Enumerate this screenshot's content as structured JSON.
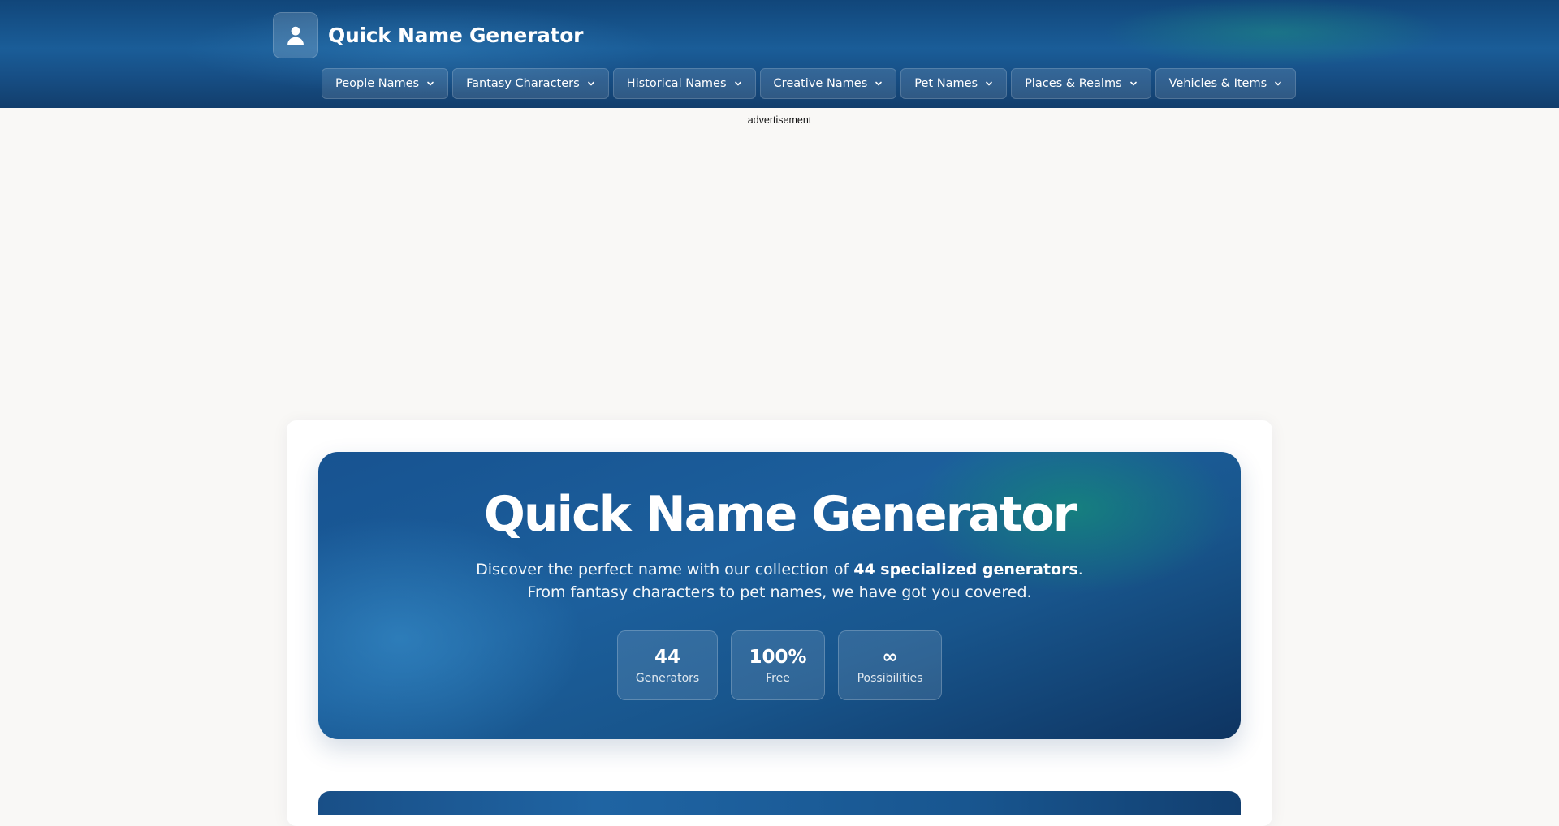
{
  "header": {
    "brand_title": "Quick Name Generator",
    "logo_icon": "user-icon",
    "nav": [
      {
        "label": "People Names"
      },
      {
        "label": "Fantasy Characters"
      },
      {
        "label": "Historical Names"
      },
      {
        "label": "Creative Names"
      },
      {
        "label": "Pet Names"
      },
      {
        "label": "Places & Realms"
      },
      {
        "label": "Vehicles & Items"
      }
    ]
  },
  "ad": {
    "label": "advertisement"
  },
  "hero": {
    "title": "Quick Name Generator",
    "sub_line1_pre": "Discover the perfect name with our collection of ",
    "sub_line1_bold": "44 specialized generators",
    "sub_line1_post": ".",
    "sub_line2": "From fantasy characters to pet names, we have got you covered.",
    "stats": [
      {
        "value": "44",
        "label": "Generators"
      },
      {
        "value": "100%",
        "label": "Free"
      },
      {
        "value": "∞",
        "label": "Possibilities"
      }
    ]
  },
  "colors": {
    "header_blue": "#1a5d98",
    "hero_blue": "#1c5f9c",
    "hero_teal_glow": "#148c78",
    "page_bg": "#f9f8f6"
  }
}
